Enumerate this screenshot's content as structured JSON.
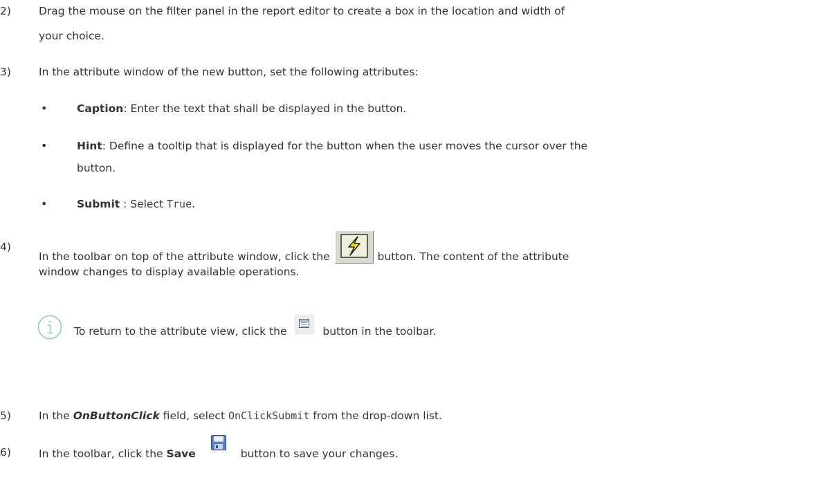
{
  "steps": {
    "s2": {
      "num": "2)",
      "text": "Drag the mouse on the filter panel in the report editor to create a box in the location and width of",
      "text2": "your choice."
    },
    "s3": {
      "num": "3)",
      "text": "In the attribute window of the new button, set the following attributes:"
    },
    "bullets": [
      {
        "term": "Caption",
        "text": ": Enter the text that shall be displayed in the button."
      },
      {
        "term": "Hint",
        "text": ": Define a tooltip that is displayed for the button when the user moves the cursor over the",
        "text2": "button."
      },
      {
        "term": "Submit",
        "text": " : Select ",
        "code": "True",
        "end": "."
      }
    ],
    "s4": {
      "num": "4)",
      "pre": "In the toolbar on top of the attribute window, click the",
      "post": "button. The content of the attribute",
      "text2": "window changes to display available operations."
    },
    "note": {
      "pre": "To return to the attribute view, click the",
      "post": "button in the toolbar."
    },
    "s5": {
      "num": "5)",
      "pre": "In the ",
      "field": "OnButtonClick",
      "mid": " field, select ",
      "code": "OnClickSubmit",
      "post": " from the drop-down list."
    },
    "s6": {
      "num": "6)",
      "pre": "In the toolbar, click the ",
      "bold": "Save",
      "post": "button to save your changes."
    }
  },
  "icons": {
    "operations": "lightning-icon",
    "attribute_view": "list-view-icon",
    "info": "info-icon",
    "save": "floppy-disk-icon"
  }
}
